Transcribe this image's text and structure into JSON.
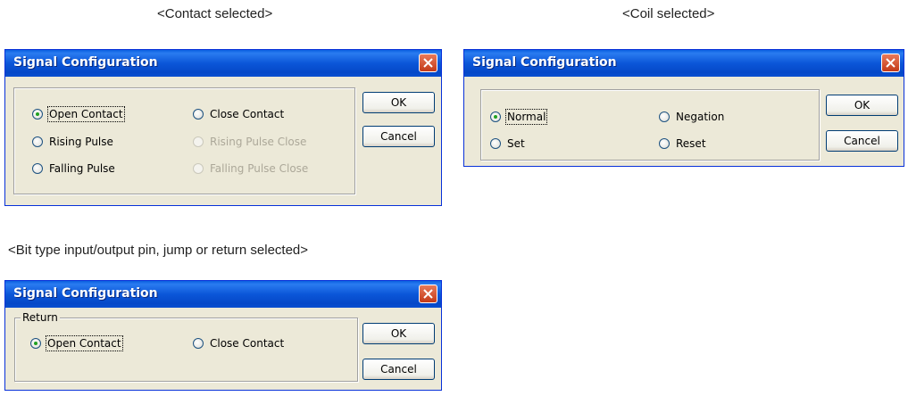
{
  "captions": {
    "contact": "<Contact selected>",
    "coil": "<Coil selected>",
    "bit": "<Bit type input/output pin, jump or return selected>"
  },
  "dialog1": {
    "title": "Signal Configuration",
    "ok": "OK",
    "cancel": "Cancel",
    "options": {
      "open_contact": "Open Contact",
      "close_contact": "Close Contact",
      "rising_pulse": "Rising Pulse",
      "rising_pulse_close": "Rising Pulse Close",
      "falling_pulse": "Falling Pulse",
      "falling_pulse_close": "Falling Pulse Close"
    },
    "selected": "Open Contact"
  },
  "dialog2": {
    "title": "Signal Configuration",
    "ok": "OK",
    "cancel": "Cancel",
    "options": {
      "normal": "Normal",
      "negation": "Negation",
      "set": "Set",
      "reset": "Reset"
    },
    "selected": "Normal"
  },
  "dialog3": {
    "title": "Signal Configuration",
    "group_label": "Return",
    "ok": "OK",
    "cancel": "Cancel",
    "options": {
      "open_contact": "Open Contact",
      "close_contact": "Close Contact"
    },
    "selected": "Open Contact"
  },
  "icons": {
    "close": "close-icon",
    "radio": "radio-icon"
  },
  "colors": {
    "titlebar": "#0b56d8",
    "dialog_bg": "#ece9d8",
    "close_button": "#c33a18",
    "disabled_text": "#aca899"
  }
}
